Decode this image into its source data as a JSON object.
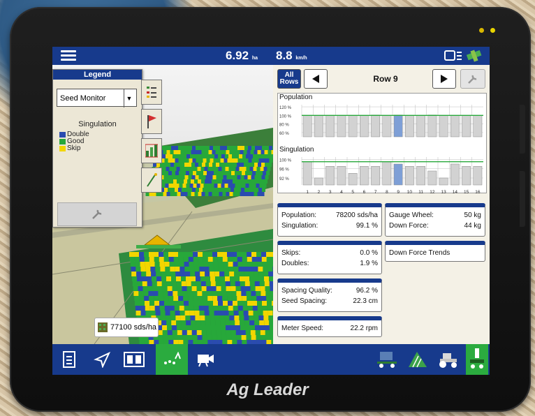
{
  "topbar": {
    "area_value": "6.92",
    "area_unit": "ha",
    "speed_value": "8.8",
    "speed_unit": "km/h"
  },
  "legend": {
    "title": "Legend",
    "selected_layer": "Seed Monitor",
    "subtitle": "Singulation",
    "items": [
      {
        "label": "Double",
        "color": "#2a4bb0"
      },
      {
        "label": "Good",
        "color": "#27a83a"
      },
      {
        "label": "Skip",
        "color": "#f2d600"
      }
    ],
    "pager": "○○●○"
  },
  "map": {
    "rate_label": "77100 sds/ha"
  },
  "row_nav": {
    "all_rows_label": "All Rows",
    "row_label": "Row 9"
  },
  "charts": {
    "population": {
      "title": "Population",
      "y_ticks": [
        "120 %",
        "100 %",
        "80 %",
        "60 %"
      ],
      "y_range": [
        50,
        125
      ],
      "target": 100,
      "highlight_row": 9,
      "values": [
        100,
        100,
        100,
        100,
        100,
        100,
        101,
        100,
        101,
        100,
        100,
        101,
        100,
        100,
        100,
        100
      ]
    },
    "singulation": {
      "title": "Singulation",
      "y_ticks": [
        "100 %",
        "96 %",
        "92 %"
      ],
      "y_range": [
        89,
        101
      ],
      "target": 99,
      "highlight_row": 9,
      "values": [
        99,
        92,
        97,
        97,
        94,
        97,
        97,
        99,
        98,
        97,
        97,
        95,
        92,
        98,
        97,
        97
      ]
    },
    "x_labels": [
      "1",
      "2",
      "3",
      "4",
      "5",
      "6",
      "7",
      "8",
      "9",
      "10",
      "11",
      "12",
      "13",
      "14",
      "15",
      "16"
    ]
  },
  "tiles": {
    "population_label": "Population:",
    "population_value": "78200 sds/ha",
    "singulation_label": "Singulation:",
    "singulation_value": "99.1 %",
    "gauge_wheel_label": "Gauge Wheel:",
    "gauge_wheel_value": "50 kg",
    "down_force_label": "Down Force:",
    "down_force_value": "44 kg",
    "skips_label": "Skips:",
    "skips_value": "0.0 %",
    "doubles_label": "Doubles:",
    "doubles_value": "1.9 %",
    "down_force_trends": "Down Force Trends",
    "spacing_quality_label": "Spacing Quality:",
    "spacing_quality_value": "96.2 %",
    "seed_spacing_label": "Seed Spacing:",
    "seed_spacing_value": "22.3 cm",
    "meter_speed_label": "Meter Speed:",
    "meter_speed_value": "22.2 rpm"
  },
  "bottombar": {
    "icons": [
      "document-icon",
      "navigate-icon",
      "split-view-icon",
      "seed-monitor-icon",
      "camera-icon",
      "planter-icon",
      "field-icon",
      "tractor-icon",
      "row-unit-icon"
    ]
  },
  "device": {
    "brand": "Ag Leader"
  },
  "colors": {
    "bar_blue": "#173a8c",
    "target_line": "#27a83a",
    "highlight_bar": "#7e9fd6",
    "bar_gray": "#d2d2d2"
  }
}
